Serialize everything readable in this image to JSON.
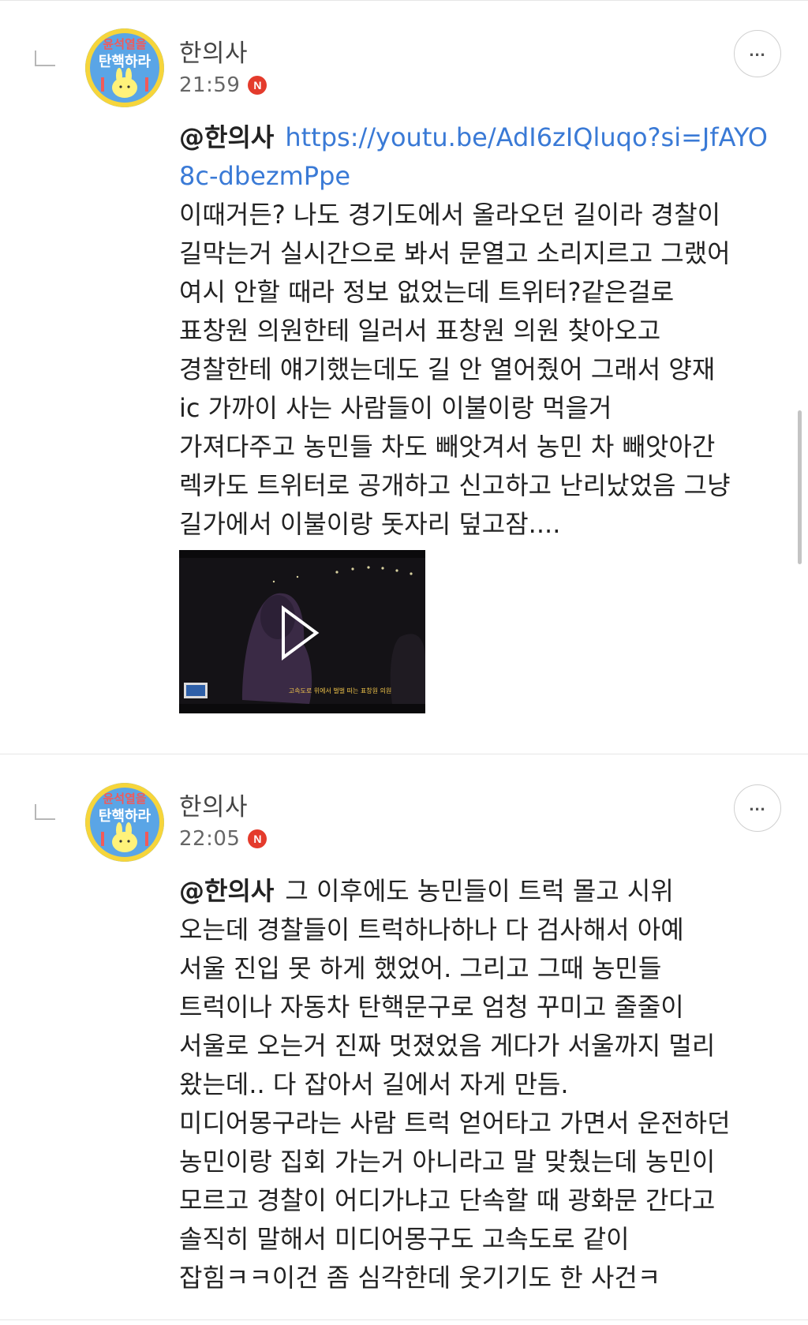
{
  "comments": [
    {
      "author": "한의사",
      "time": "21:59",
      "new_badge": "N",
      "mention": "@한의사",
      "link": "https://youtu.be/AdI6zIQluqo?si=JfAYO8c-dbezmPpe",
      "text": "이때거든? 나도 경기도에서 올라오던 길이라 경찰이\n길막는거 실시간으로 봐서 문열고 소리지르고 그랬어\n여시 안할 때라 정보 없었는데 트위터?같은걸로\n표창원 의원한테 일러서 표창원 의원 찾아오고\n경찰한테 얘기했는데도 길 안 열어줬어 그래서 양재\nic 가까이 사는 사람들이 이불이랑 먹을거\n가져다주고 농민들 차도 빼앗겨서 농민 차 빼앗아간\n렉카도 트위터로 공개하고 신고하고 난리났었음 그냥\n길가에서 이불이랑 돗자리 덮고잠....",
      "thumbnail": {
        "caption": "고속도로 위에서 벌벌 떠는 표창원 의원",
        "play_icon": "play-icon"
      }
    },
    {
      "author": "한의사",
      "time": "22:05",
      "new_badge": "N",
      "mention": "@한의사",
      "text": "그 이후에도 농민들이 트럭 몰고 시위\n오는데 경찰들이 트럭하나하나 다 검사해서 아예\n서울 진입 못 하게 했었어. 그리고 그때 농민들\n트럭이나 자동차 탄핵문구로 엄청 꾸미고 줄줄이\n서울로 오는거 진짜 멋졌었음 게다가 서울까지 멀리\n왔는데.. 다 잡아서 길에서 자게 만듬.\n미디어몽구라는 사람 트럭 얻어타고 가면서 운전하던\n농민이랑 집회 가는거 아니라고 말 맞췄는데 농민이\n모르고 경찰이 어디가냐고 단속할 때 광화문 간다고\n솔직히 말해서 미디어몽구도 고속도로 같이\n잡힘ㅋㅋ이건 좀 심각한데 웃기기도 한 사건ㅋ"
    }
  ],
  "avatar": {
    "text_top": "윤석열을",
    "text_main": "탄핵하라"
  },
  "more_button": "...",
  "colors": {
    "link": "#3a7ad6",
    "badge": "#e43b2c",
    "avatar_bg": "#5aa5e6",
    "avatar_ring": "#f6d53b"
  }
}
